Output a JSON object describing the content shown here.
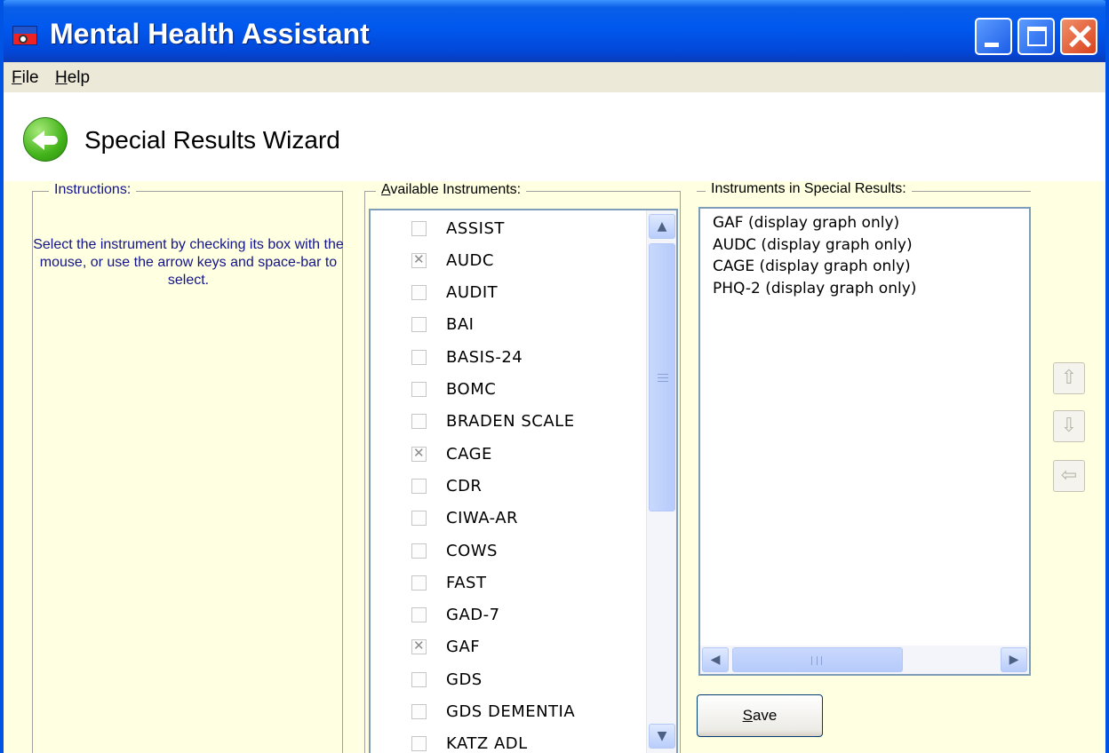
{
  "window": {
    "title": "Mental Health Assistant",
    "controls": [
      "minimize",
      "maximize",
      "close"
    ]
  },
  "menubar": {
    "items": [
      {
        "label": "File",
        "mnemonic": "F"
      },
      {
        "label": "Help",
        "mnemonic": "H"
      }
    ]
  },
  "header": {
    "back_icon": "back-arrow-icon",
    "title": "Special Results Wizard"
  },
  "instructions": {
    "label": "Instructions:",
    "text": "Select the instrument by checking its box with the mouse, or use the arrow keys and space-bar to select."
  },
  "available": {
    "label": "Available Instruments:",
    "items": [
      {
        "label": "ASSIST",
        "checked": false
      },
      {
        "label": "AUDC",
        "checked": true
      },
      {
        "label": "AUDIT",
        "checked": false
      },
      {
        "label": "BAI",
        "checked": false
      },
      {
        "label": "BASIS-24",
        "checked": false
      },
      {
        "label": "BOMC",
        "checked": false
      },
      {
        "label": "BRADEN SCALE",
        "checked": false
      },
      {
        "label": "CAGE",
        "checked": true
      },
      {
        "label": "CDR",
        "checked": false
      },
      {
        "label": "CIWA-AR",
        "checked": false
      },
      {
        "label": "COWS",
        "checked": false
      },
      {
        "label": "FAST",
        "checked": false
      },
      {
        "label": "GAD-7",
        "checked": false
      },
      {
        "label": "GAF",
        "checked": true
      },
      {
        "label": "GDS",
        "checked": false
      },
      {
        "label": "GDS DEMENTIA",
        "checked": false
      },
      {
        "label": "KATZ ADL",
        "checked": false
      }
    ]
  },
  "special_results": {
    "label": "Instruments in Special Results:",
    "items": [
      "GAF (display graph only)",
      "AUDC (display graph only)",
      "CAGE (display graph only)",
      "PHQ-2 (display graph only)"
    ]
  },
  "side_buttons": [
    {
      "icon": "move-up-arrow-icon",
      "glyph": "⇧"
    },
    {
      "icon": "move-down-arrow-icon",
      "glyph": "⇩"
    },
    {
      "icon": "remove-left-arrow-icon",
      "glyph": "⇦"
    }
  ],
  "save_button": {
    "label": "Save",
    "mnemonic": "S"
  },
  "scroll_glyphs": {
    "up": "▲",
    "down": "▼",
    "left": "◀",
    "right": "▶"
  },
  "colors": {
    "title_bar": "#0058ee",
    "panel_background": "#ffffe1",
    "instructions_text": "#14148a",
    "close_button": "#d9421c"
  }
}
